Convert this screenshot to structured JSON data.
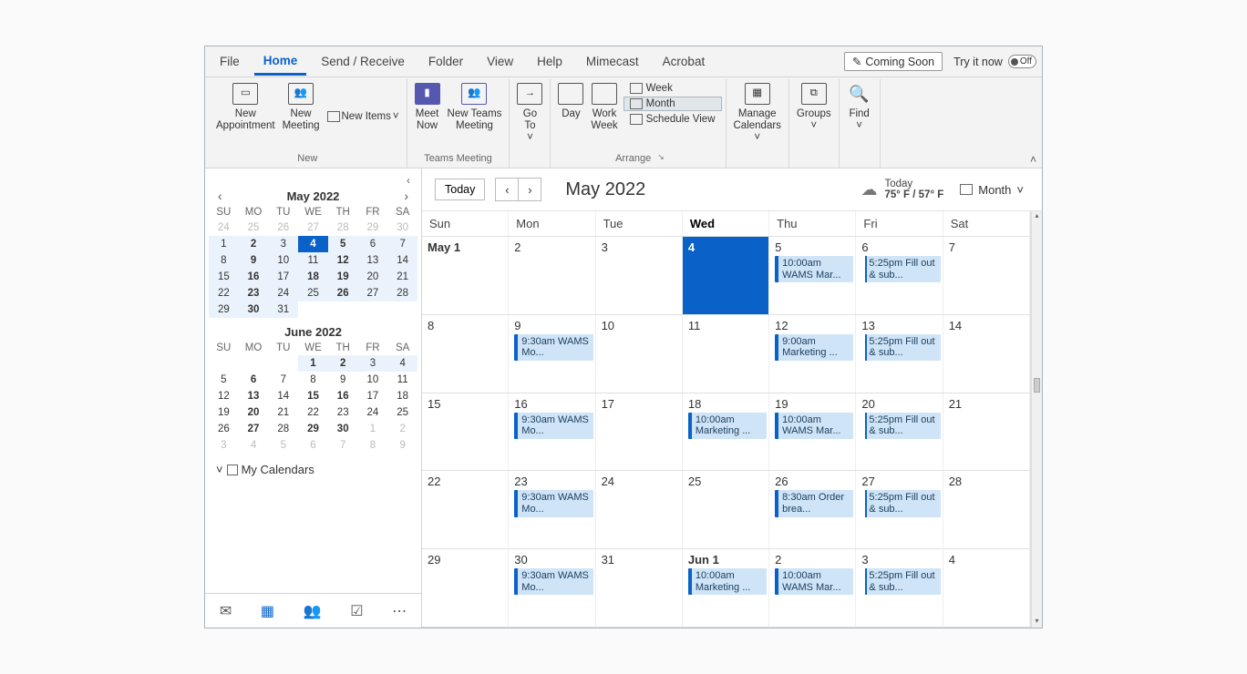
{
  "ribbon": {
    "tabs": [
      "File",
      "Home",
      "Send / Receive",
      "Folder",
      "View",
      "Help",
      "Mimecast",
      "Acrobat"
    ],
    "active_tab": "Home",
    "coming_soon": "Coming Soon",
    "try_it": "Try it now",
    "toggle_label": "Off",
    "groups": {
      "new": {
        "label": "New",
        "new_appointment": "New\nAppointment",
        "new_meeting": "New\nMeeting",
        "new_items": "New Items"
      },
      "teams": {
        "label": "Teams Meeting",
        "meet_now": "Meet\nNow",
        "new_teams_meeting": "New Teams\nMeeting"
      },
      "goto": {
        "goto": "Go\nTo"
      },
      "arrange": {
        "label": "Arrange",
        "day": "Day",
        "work_week": "Work\nWeek",
        "week": "Week",
        "month": "Month",
        "schedule_view": "Schedule View"
      },
      "manage": {
        "label": "Manage\nCalendars"
      },
      "groups_g": {
        "label": "Groups"
      },
      "find": {
        "label": "Find"
      }
    }
  },
  "sidebar": {
    "month1": {
      "title": "May 2022",
      "dow": [
        "SU",
        "MO",
        "TU",
        "WE",
        "TH",
        "FR",
        "SA"
      ],
      "days": [
        {
          "d": "24",
          "out": true
        },
        {
          "d": "25",
          "out": true
        },
        {
          "d": "26",
          "out": true
        },
        {
          "d": "27",
          "out": true
        },
        {
          "d": "28",
          "out": true
        },
        {
          "d": "29",
          "out": true
        },
        {
          "d": "30",
          "out": true
        },
        {
          "d": "1",
          "in": true
        },
        {
          "d": "2",
          "in": true,
          "b": true
        },
        {
          "d": "3",
          "in": true
        },
        {
          "d": "4",
          "today": true
        },
        {
          "d": "5",
          "in": true,
          "b": true
        },
        {
          "d": "6",
          "in": true
        },
        {
          "d": "7",
          "in": true
        },
        {
          "d": "8",
          "in": true
        },
        {
          "d": "9",
          "in": true,
          "b": true
        },
        {
          "d": "10",
          "in": true
        },
        {
          "d": "11",
          "in": true
        },
        {
          "d": "12",
          "in": true,
          "b": true
        },
        {
          "d": "13",
          "in": true
        },
        {
          "d": "14",
          "in": true
        },
        {
          "d": "15",
          "in": true
        },
        {
          "d": "16",
          "in": true,
          "b": true
        },
        {
          "d": "17",
          "in": true
        },
        {
          "d": "18",
          "in": true,
          "b": true
        },
        {
          "d": "19",
          "in": true,
          "b": true
        },
        {
          "d": "20",
          "in": true
        },
        {
          "d": "21",
          "in": true
        },
        {
          "d": "22",
          "in": true
        },
        {
          "d": "23",
          "in": true,
          "b": true
        },
        {
          "d": "24",
          "in": true
        },
        {
          "d": "25",
          "in": true
        },
        {
          "d": "26",
          "in": true,
          "b": true
        },
        {
          "d": "27",
          "in": true
        },
        {
          "d": "28",
          "in": true
        },
        {
          "d": "29",
          "in": true
        },
        {
          "d": "30",
          "in": true,
          "b": true
        },
        {
          "d": "31",
          "in": true
        }
      ]
    },
    "month2": {
      "title": "June 2022",
      "dow": [
        "SU",
        "MO",
        "TU",
        "WE",
        "TH",
        "FR",
        "SA"
      ],
      "days": [
        {
          "d": "",
          "out": true
        },
        {
          "d": "",
          "out": true
        },
        {
          "d": "",
          "out": true
        },
        {
          "d": "1",
          "in": true,
          "b": true
        },
        {
          "d": "2",
          "in": true,
          "b": true
        },
        {
          "d": "3",
          "in": true
        },
        {
          "d": "4",
          "in": true
        },
        {
          "d": "5"
        },
        {
          "d": "6",
          "b": true
        },
        {
          "d": "7"
        },
        {
          "d": "8"
        },
        {
          "d": "9"
        },
        {
          "d": "10"
        },
        {
          "d": "11"
        },
        {
          "d": "12"
        },
        {
          "d": "13",
          "b": true
        },
        {
          "d": "14"
        },
        {
          "d": "15",
          "b": true
        },
        {
          "d": "16",
          "b": true
        },
        {
          "d": "17"
        },
        {
          "d": "18"
        },
        {
          "d": "19"
        },
        {
          "d": "20",
          "b": true
        },
        {
          "d": "21"
        },
        {
          "d": "22"
        },
        {
          "d": "23"
        },
        {
          "d": "24"
        },
        {
          "d": "25"
        },
        {
          "d": "26"
        },
        {
          "d": "27",
          "b": true
        },
        {
          "d": "28"
        },
        {
          "d": "29",
          "b": true
        },
        {
          "d": "30",
          "b": true
        },
        {
          "d": "1",
          "out": true
        },
        {
          "d": "2",
          "out": true
        },
        {
          "d": "3",
          "out": true
        },
        {
          "d": "4",
          "out": true
        },
        {
          "d": "5",
          "out": true
        },
        {
          "d": "6",
          "out": true
        },
        {
          "d": "7",
          "out": true
        },
        {
          "d": "8",
          "out": true
        },
        {
          "d": "9",
          "out": true
        }
      ]
    },
    "my_calendars": "My Calendars"
  },
  "main": {
    "today_btn": "Today",
    "title": "May 2022",
    "weather": {
      "label": "Today",
      "temps": "75° F / 57° F"
    },
    "view": "Month",
    "dow": [
      {
        "l": "Sun"
      },
      {
        "l": "Mon"
      },
      {
        "l": "Tue"
      },
      {
        "l": "Wed",
        "b": true
      },
      {
        "l": "Thu"
      },
      {
        "l": "Fri"
      },
      {
        "l": "Sat"
      }
    ],
    "weeks": [
      [
        {
          "date": "May 1",
          "b": true
        },
        {
          "date": "2"
        },
        {
          "date": "3"
        },
        {
          "date": "4",
          "today": true
        },
        {
          "date": "5",
          "events": [
            {
              "t": "10:00am WAMS Mar..."
            }
          ]
        },
        {
          "date": "6",
          "events": [
            {
              "t": "5:25pm Fill out & sub...",
              "tent": true
            }
          ]
        },
        {
          "date": "7"
        }
      ],
      [
        {
          "date": "8"
        },
        {
          "date": "9",
          "events": [
            {
              "t": "9:30am WAMS Mo..."
            }
          ]
        },
        {
          "date": "10"
        },
        {
          "date": "11"
        },
        {
          "date": "12",
          "events": [
            {
              "t": "9:00am Marketing ..."
            }
          ]
        },
        {
          "date": "13",
          "events": [
            {
              "t": "5:25pm Fill out & sub...",
              "tent": true
            }
          ]
        },
        {
          "date": "14"
        }
      ],
      [
        {
          "date": "15"
        },
        {
          "date": "16",
          "events": [
            {
              "t": "9:30am WAMS Mo..."
            }
          ]
        },
        {
          "date": "17"
        },
        {
          "date": "18",
          "events": [
            {
              "t": "10:00am Marketing ..."
            }
          ]
        },
        {
          "date": "19",
          "events": [
            {
              "t": "10:00am WAMS Mar..."
            }
          ]
        },
        {
          "date": "20",
          "events": [
            {
              "t": "5:25pm Fill out & sub...",
              "tent": true
            }
          ]
        },
        {
          "date": "21"
        }
      ],
      [
        {
          "date": "22"
        },
        {
          "date": "23",
          "events": [
            {
              "t": "9:30am WAMS Mo..."
            }
          ]
        },
        {
          "date": "24"
        },
        {
          "date": "25"
        },
        {
          "date": "26",
          "events": [
            {
              "t": "8:30am Order brea..."
            }
          ]
        },
        {
          "date": "27",
          "events": [
            {
              "t": "5:25pm Fill out & sub...",
              "tent": true
            }
          ]
        },
        {
          "date": "28"
        }
      ],
      [
        {
          "date": "29"
        },
        {
          "date": "30",
          "events": [
            {
              "t": "9:30am WAMS Mo..."
            }
          ]
        },
        {
          "date": "31"
        },
        {
          "date": "Jun 1",
          "b": true,
          "events": [
            {
              "t": "10:00am Marketing ..."
            }
          ]
        },
        {
          "date": "2",
          "events": [
            {
              "t": "10:00am WAMS Mar..."
            }
          ]
        },
        {
          "date": "3",
          "events": [
            {
              "t": "5:25pm Fill out & sub...",
              "tent": true
            }
          ]
        },
        {
          "date": "4"
        }
      ]
    ]
  }
}
